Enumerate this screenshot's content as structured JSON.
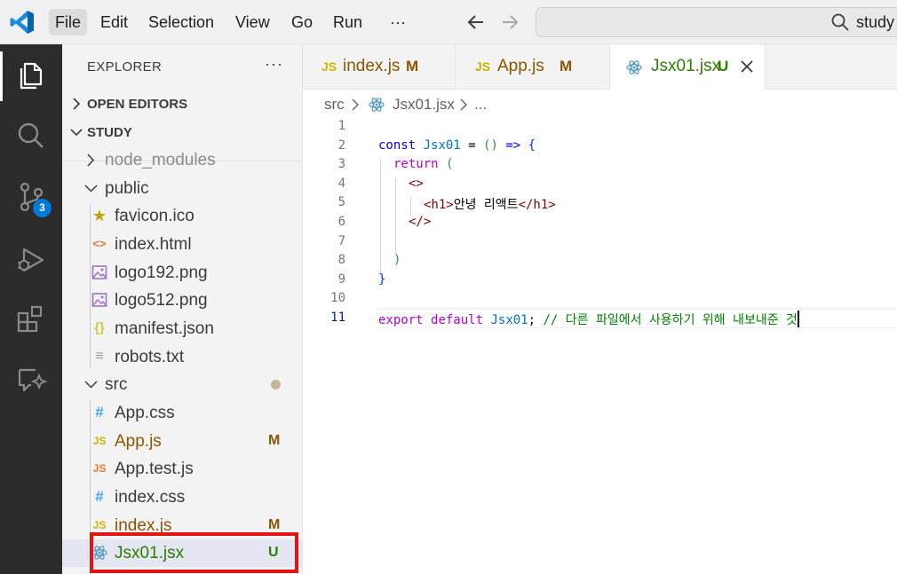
{
  "menu": {
    "items": [
      "File",
      "Edit",
      "Selection",
      "View",
      "Go",
      "Run",
      "···"
    ],
    "active": "File",
    "search_text": "study"
  },
  "activity_bar": {
    "icons": [
      "explorer-icon",
      "search-icon",
      "source-control-icon",
      "run-debug-icon",
      "extensions-icon",
      "chat-icon"
    ],
    "source_control_badge": "3"
  },
  "sidebar": {
    "title": "EXPLORER",
    "more": "···",
    "open_editors_label": "OPEN EDITORS",
    "study_label": "STUDY",
    "tree": [
      {
        "name": "node_modules",
        "kind": "folder-collapsed",
        "status": ""
      },
      {
        "name": "public",
        "kind": "folder-open",
        "status": ""
      },
      {
        "name": "favicon.ico",
        "kind": "star",
        "icon": "★",
        "status": ""
      },
      {
        "name": "index.html",
        "kind": "html",
        "icon": "<>",
        "status": ""
      },
      {
        "name": "logo192.png",
        "kind": "image",
        "icon": "",
        "status": ""
      },
      {
        "name": "logo512.png",
        "kind": "image",
        "icon": "",
        "status": ""
      },
      {
        "name": "manifest.json",
        "kind": "json",
        "icon": "{}",
        "status": ""
      },
      {
        "name": "robots.txt",
        "kind": "text",
        "icon": "≡",
        "status": ""
      },
      {
        "name": "src",
        "kind": "folder-open",
        "status": ""
      },
      {
        "name": "App.css",
        "kind": "css",
        "icon": "#",
        "status": ""
      },
      {
        "name": "App.js",
        "kind": "js",
        "icon": "JS",
        "status": "M"
      },
      {
        "name": "App.test.js",
        "kind": "test",
        "icon": "JS",
        "status": ""
      },
      {
        "name": "index.css",
        "kind": "css",
        "icon": "#",
        "status": ""
      },
      {
        "name": "index.js",
        "kind": "js",
        "icon": "JS",
        "status": "M"
      },
      {
        "name": "Jsx01.jsx",
        "kind": "react",
        "icon": "",
        "status": "U"
      }
    ]
  },
  "tabs": [
    {
      "icon": "JS",
      "label": "index.js",
      "status": "M",
      "active": false
    },
    {
      "icon": "JS",
      "label": "App.js",
      "status": "M",
      "active": false
    },
    {
      "icon": "",
      "label": "Jsx01.jsx",
      "status": "U",
      "active": true
    }
  ],
  "breadcrumb": {
    "folder": "src",
    "sep": ">",
    "file": "Jsx01.jsx",
    "ellipsis": "..."
  },
  "editor": {
    "line_numbers": [
      "1",
      "2",
      "3",
      "4",
      "5",
      "6",
      "7",
      "8",
      "9",
      "10",
      "11"
    ],
    "current_line": "11",
    "tokens": {
      "l2_const": "const",
      "l2_name": "Jsx01",
      "l2_eq": " = ",
      "l2_parens": "()",
      "l2_arrow": " => ",
      "l2_brace": "{",
      "l3_return": "return",
      "l3_paren": "(",
      "l4_open_frag": "<>",
      "l5_open_tag": "<h1>",
      "l5_text": "안녕 리액트",
      "l5_close_tag": "</h1>",
      "l6_close_frag": "</>",
      "l8_paren": ")",
      "l9_brace": "}",
      "l11_export": "export",
      "l11_default": "default",
      "l11_name": "Jsx01",
      "l11_semi": ";",
      "l11_comment": "// 다른 파일에서 사용하기 위해 내보내준 것"
    }
  },
  "colors": {
    "activity_bar_bg": "#2c2c2c",
    "sidebar_bg": "#f3f3f3",
    "badge": "#0078d4",
    "modified": "#895503",
    "untracked": "#2e7d00",
    "highlight_box": "#e11414"
  }
}
